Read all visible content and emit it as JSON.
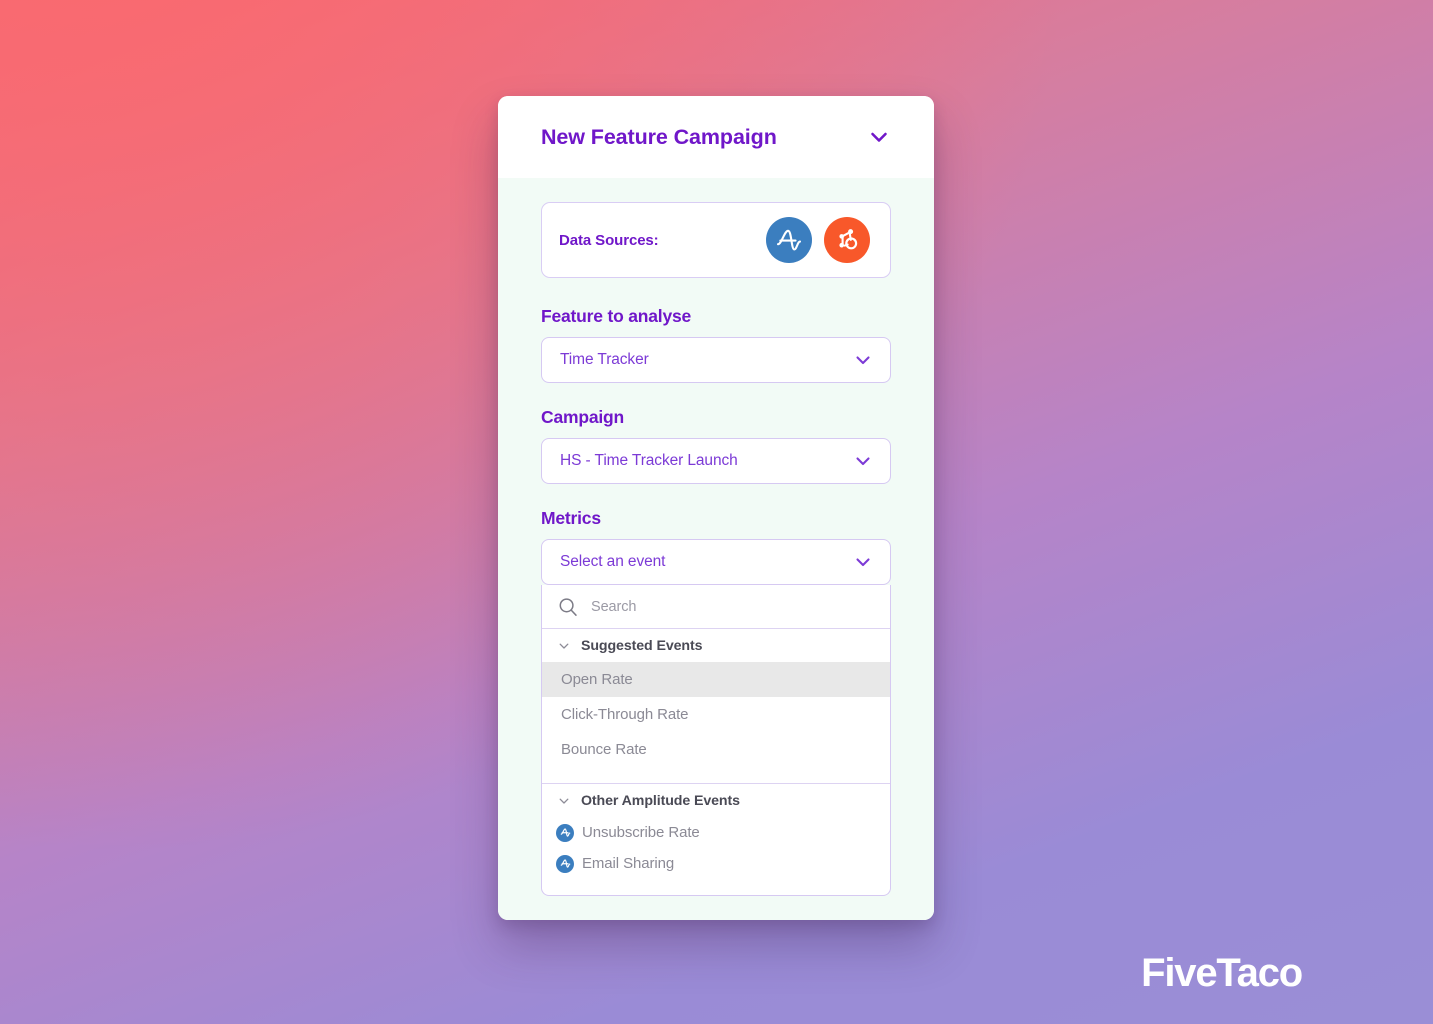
{
  "colors": {
    "brand_purple": "#7017c9",
    "value_purple": "#7c3ad6",
    "amplitude_blue": "#3b7ebf",
    "hubspot_orange": "#f8582a",
    "card_bg": "#f2fbf6",
    "highlight_gray": "#e8e8e8",
    "field_border": "#d6c9f2",
    "bg_gradient_start": "#f4697a",
    "bg_gradient_end": "#9a8ed6"
  },
  "header": {
    "title": "New Feature Campaign",
    "collapse_icon": "chevron-down-icon"
  },
  "data_sources": {
    "label": "Data Sources:",
    "sources": [
      {
        "name": "Amplitude",
        "icon": "amplitude-icon"
      },
      {
        "name": "HubSpot",
        "icon": "hubspot-icon"
      }
    ]
  },
  "feature": {
    "label": "Feature to analyse",
    "value": "Time Tracker",
    "chevron_icon": "chevron-down-icon"
  },
  "campaign": {
    "label": "Campaign",
    "value": "HS - Time Tracker Launch",
    "chevron_icon": "chevron-down-icon"
  },
  "metrics": {
    "label": "Metrics",
    "select_value": "Select an event",
    "chevron_icon": "chevron-down-icon",
    "search": {
      "placeholder": "Search",
      "value": "",
      "icon": "search-icon"
    },
    "groups": [
      {
        "title": "Suggested Events",
        "caret_icon": "chevron-down-icon",
        "options": [
          {
            "label": "Open Rate",
            "highlighted": true,
            "icon": null
          },
          {
            "label": "Click-Through Rate",
            "highlighted": false,
            "icon": null
          },
          {
            "label": "Bounce Rate",
            "highlighted": false,
            "icon": null
          }
        ]
      },
      {
        "title": "Other Amplitude Events",
        "caret_icon": "chevron-down-icon",
        "options": [
          {
            "label": "Unsubscribe Rate",
            "highlighted": false,
            "icon": "amplitude-icon"
          },
          {
            "label": "Email Sharing",
            "highlighted": false,
            "icon": "amplitude-icon"
          }
        ]
      }
    ]
  },
  "watermark": {
    "text": "FiveTaco"
  }
}
